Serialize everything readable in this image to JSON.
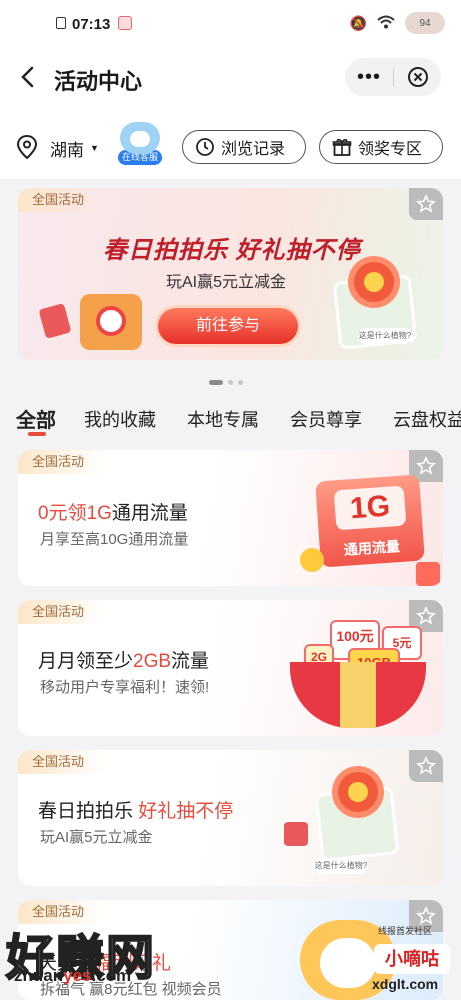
{
  "status_bar": {
    "time": "07:13",
    "battery": "94"
  },
  "nav": {
    "title": "活动中心",
    "more": "•••"
  },
  "toolbar": {
    "city": "湖南",
    "service_label": "在线客服",
    "history_label": "浏览记录",
    "prize_label": "领奖专区"
  },
  "banner": {
    "tag": "全国活动",
    "headline": "春日拍拍乐 好礼抽不停",
    "subtitle": "玩AI赢5元立减金",
    "cta": "前往参与",
    "bubble": "这是什么植物?"
  },
  "tabs": [
    "全部",
    "我的收藏",
    "本地专属",
    "会员尊享",
    "云盘权益"
  ],
  "cards": [
    {
      "tag": "全国活动",
      "title_hl": "0元领1G",
      "title_rest": "通用流量",
      "desc": "月享至高10G通用流量",
      "art_big": "1G",
      "art_label": "通用流量"
    },
    {
      "tag": "全国活动",
      "title_pre": "月月领至少",
      "title_hl": "2GB",
      "title_post": "流量",
      "desc": "移动用户专享福利！速领!",
      "coupons": [
        "100元",
        "5元",
        "10GB",
        "2G"
      ]
    },
    {
      "tag": "全国活动",
      "title_pre": "春日拍拍乐 ",
      "title_hl": "好礼抽不停",
      "desc": "玩AI赢5元立减金",
      "bubble": "这是什么植物?"
    },
    {
      "tag": "全国活动",
      "title_pre": "天天抽",
      "title_hl": "福利好礼",
      "desc": "拆福气 赢8元红包 视频会员"
    }
  ],
  "watermark": {
    "text": "好赚网",
    "url_pre": "zhuan",
    "url_red": "yes",
    "url_post": ".com",
    "logo2": "小嘀咕",
    "logo2_top": "线报首发社区",
    "logo2_bottom": "xdglt.com"
  }
}
